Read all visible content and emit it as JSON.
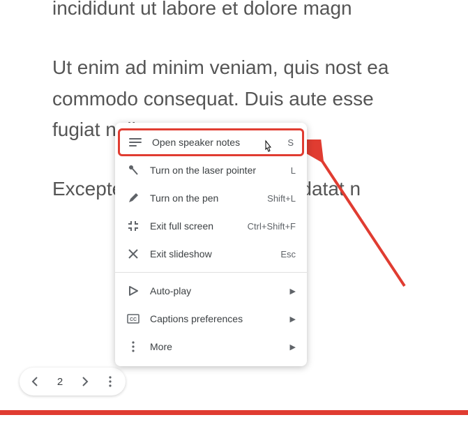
{
  "slide": {
    "line1": "incididunt ut labore et dolore magn",
    "line2": "Ut enim ad minim veniam, quis nost ea commodo consequat. Duis aute esse                                  fugiat nulla pa",
    "line3": "Excepteur sint occaecat cupidatat n"
  },
  "menu": {
    "items": [
      {
        "label": "Open speaker notes",
        "shortcut": "S",
        "highlighted": true
      },
      {
        "label": "Turn on the laser pointer",
        "shortcut": "L"
      },
      {
        "label": "Turn on the pen",
        "shortcut": "Shift+L"
      },
      {
        "label": "Exit full screen",
        "shortcut": "Ctrl+Shift+F"
      },
      {
        "label": "Exit slideshow",
        "shortcut": "Esc"
      }
    ],
    "submenu_items": [
      {
        "label": "Auto-play"
      },
      {
        "label": "Captions preferences"
      },
      {
        "label": "More"
      }
    ]
  },
  "nav": {
    "current_slide": "2"
  }
}
